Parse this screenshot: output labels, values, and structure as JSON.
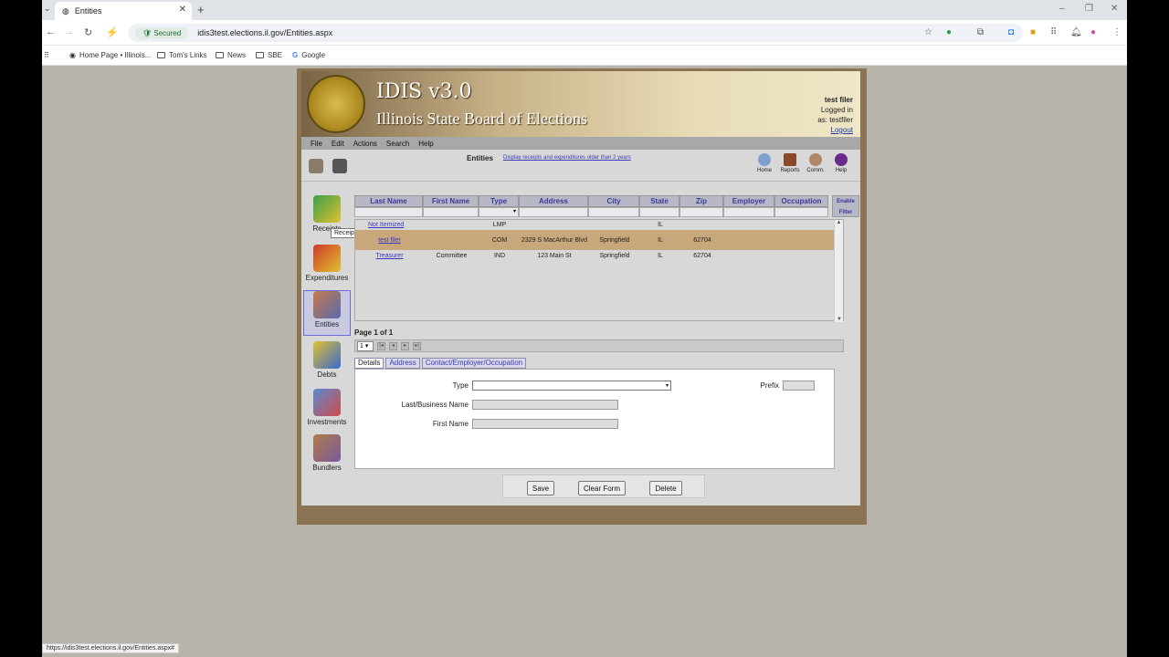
{
  "browser": {
    "tab_title": "Entities",
    "url": "idis3test.elections.il.gov/Entities.aspx",
    "secured_label": "Secured",
    "bookmarks": [
      "Home Page • Illinois...",
      "Tom's Links",
      "News",
      "SBE",
      "Google"
    ],
    "status_url": "https://idis3test.elections.il.gov/Entities.aspx#"
  },
  "app": {
    "title": "IDIS v3.0",
    "subtitle": "Illinois State Board of Elections",
    "user_name": "test filer",
    "logged_in": "Logged in",
    "as_user": "as: testfiler",
    "logout": "Logout",
    "menu": [
      "File",
      "Edit",
      "Actions",
      "Search",
      "Help"
    ],
    "page_title": "Entities",
    "older_link": "Display receipts and expenditures older than 2 years",
    "top_nav": [
      "Home",
      "Reports",
      "Comm.",
      "Help"
    ]
  },
  "sidenav": {
    "items": [
      "Receipts",
      "Expenditures",
      "Entities",
      "Debts",
      "Investments",
      "Bundlers"
    ],
    "active": "Entities",
    "tooltip": "Receipts"
  },
  "grid": {
    "columns": [
      "Last Name",
      "First Name",
      "Type",
      "Address",
      "City",
      "State",
      "Zip",
      "Employer",
      "Occupation"
    ],
    "enable_filter": "Enable Filter",
    "rows": [
      {
        "last": "Not Itemized",
        "first": "",
        "type": "LMP",
        "address": "",
        "city": "",
        "state": "IL",
        "zip": "",
        "employer": "",
        "occupation": ""
      },
      {
        "last": "test filer",
        "first": "",
        "type": "COM",
        "address": "2329 S MacArthur Blvd",
        "city": "Springfield",
        "state": "IL",
        "zip": "62704",
        "employer": "",
        "occupation": ""
      },
      {
        "last": "Treasurer",
        "first": "Committee",
        "type": "IND",
        "address": "123 Main St",
        "city": "Springfield",
        "state": "IL",
        "zip": "62704",
        "employer": "",
        "occupation": ""
      }
    ],
    "selected_row": 1,
    "page_label": "Page 1 of 1",
    "page_select": "1"
  },
  "form": {
    "tabs": [
      "Details",
      "Address",
      "Contact/Employer/Occupation"
    ],
    "type_label": "Type",
    "prefix_label": "Prefix",
    "last_label": "Last/Business Name",
    "first_label": "First Name"
  },
  "buttons": {
    "save": "Save",
    "clear": "Clear Form",
    "delete": "Delete"
  },
  "colors": {
    "selected_row": "#c8a87a",
    "header_link": "#3b3b9a"
  }
}
